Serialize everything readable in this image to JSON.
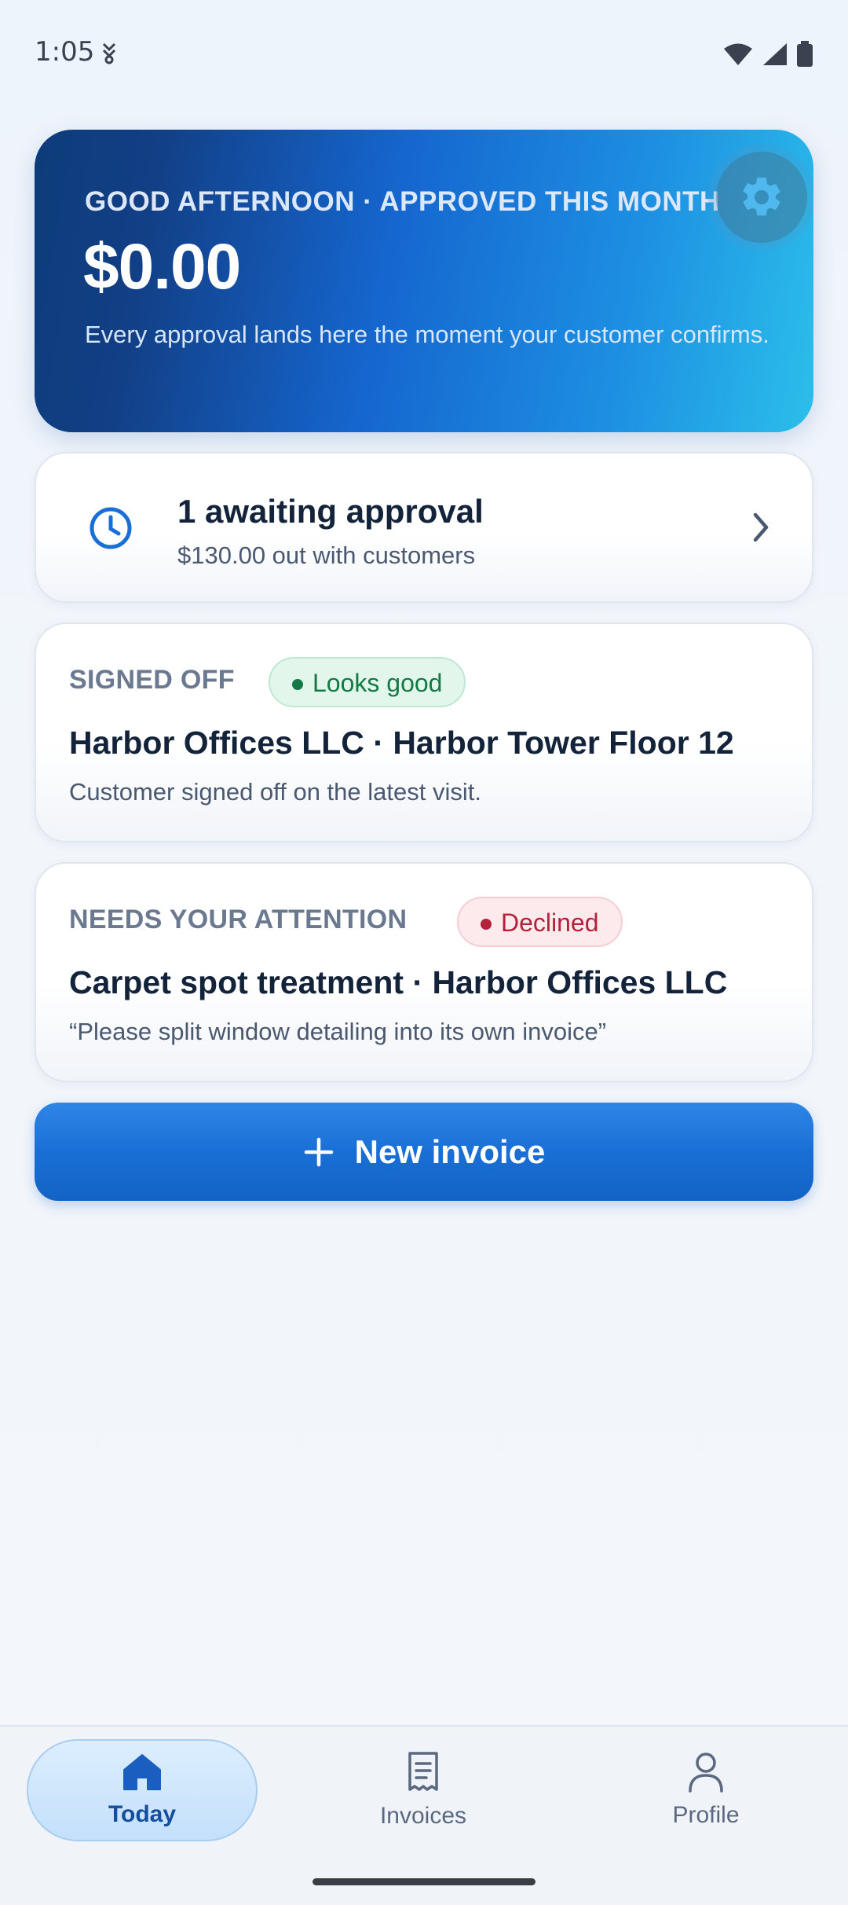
{
  "status_bar": {
    "time": "1:05"
  },
  "hero": {
    "eyebrow": "GOOD AFTERNOON · APPROVED THIS MONTH",
    "amount": "$0.00",
    "description": "Every approval lands here the moment your customer confirms.",
    "settings_icon": "gear-icon"
  },
  "awaiting": {
    "title": "1 awaiting approval",
    "subtitle": "$130.00 out with customers",
    "icon": "clock-icon"
  },
  "signed_off": {
    "eyebrow": "SIGNED OFF",
    "badge": "Looks good",
    "headline": "Harbor Offices LLC · Harbor Tower Floor 12",
    "detail": "Customer signed off on the latest visit."
  },
  "needs_attention": {
    "eyebrow": "NEEDS YOUR ATTENTION",
    "badge": "Declined",
    "headline": "Carpet spot treatment · Harbor Offices LLC",
    "detail": "“Please split window detailing into its own invoice”"
  },
  "new_invoice": {
    "label": "New invoice"
  },
  "nav": {
    "items": [
      {
        "label": "Today",
        "icon": "home-icon",
        "active": true
      },
      {
        "label": "Invoices",
        "icon": "receipt-icon",
        "active": false
      },
      {
        "label": "Profile",
        "icon": "person-icon",
        "active": false
      }
    ]
  },
  "colors": {
    "accent": "#1a6fd6",
    "success": "#137a45",
    "danger": "#b3213a",
    "text": "#13233a"
  }
}
